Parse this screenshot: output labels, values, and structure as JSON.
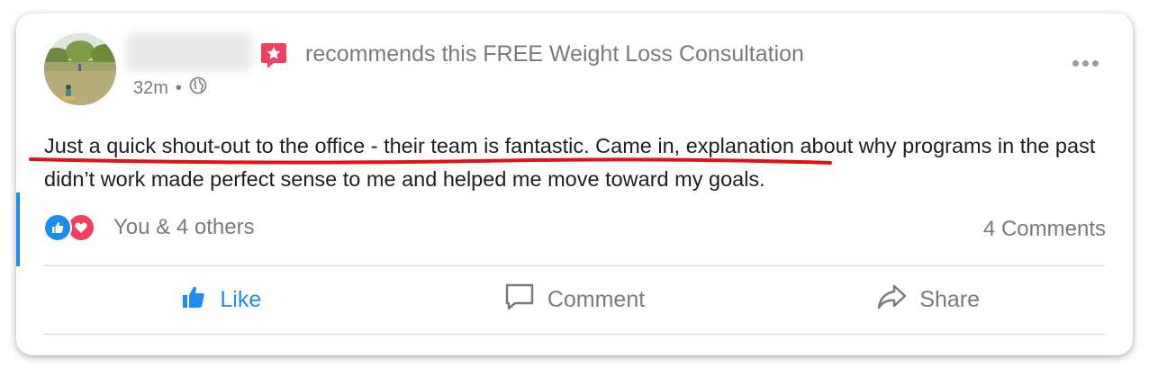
{
  "post": {
    "author_name": "",
    "recommend_text": "recommends this FREE Weight Loss Consultation",
    "time": "32m",
    "separator": "•",
    "body": "Just a quick shout-out to the office - their team is fantastic. Came in, explanation about why programs in the past didn’t work made perfect sense to me and helped me move toward my goals."
  },
  "reactions": {
    "summary": "You & 4 others",
    "comments": "4 Comments",
    "icons": [
      "like-icon",
      "love-icon"
    ]
  },
  "actions": {
    "like": "Like",
    "comment": "Comment",
    "share": "Share"
  },
  "colors": {
    "accent": "#1d8cf0",
    "love": "#f0405d",
    "badge": "#f0405d",
    "underline": "#e3101a",
    "muted": "#7a7a7a"
  }
}
